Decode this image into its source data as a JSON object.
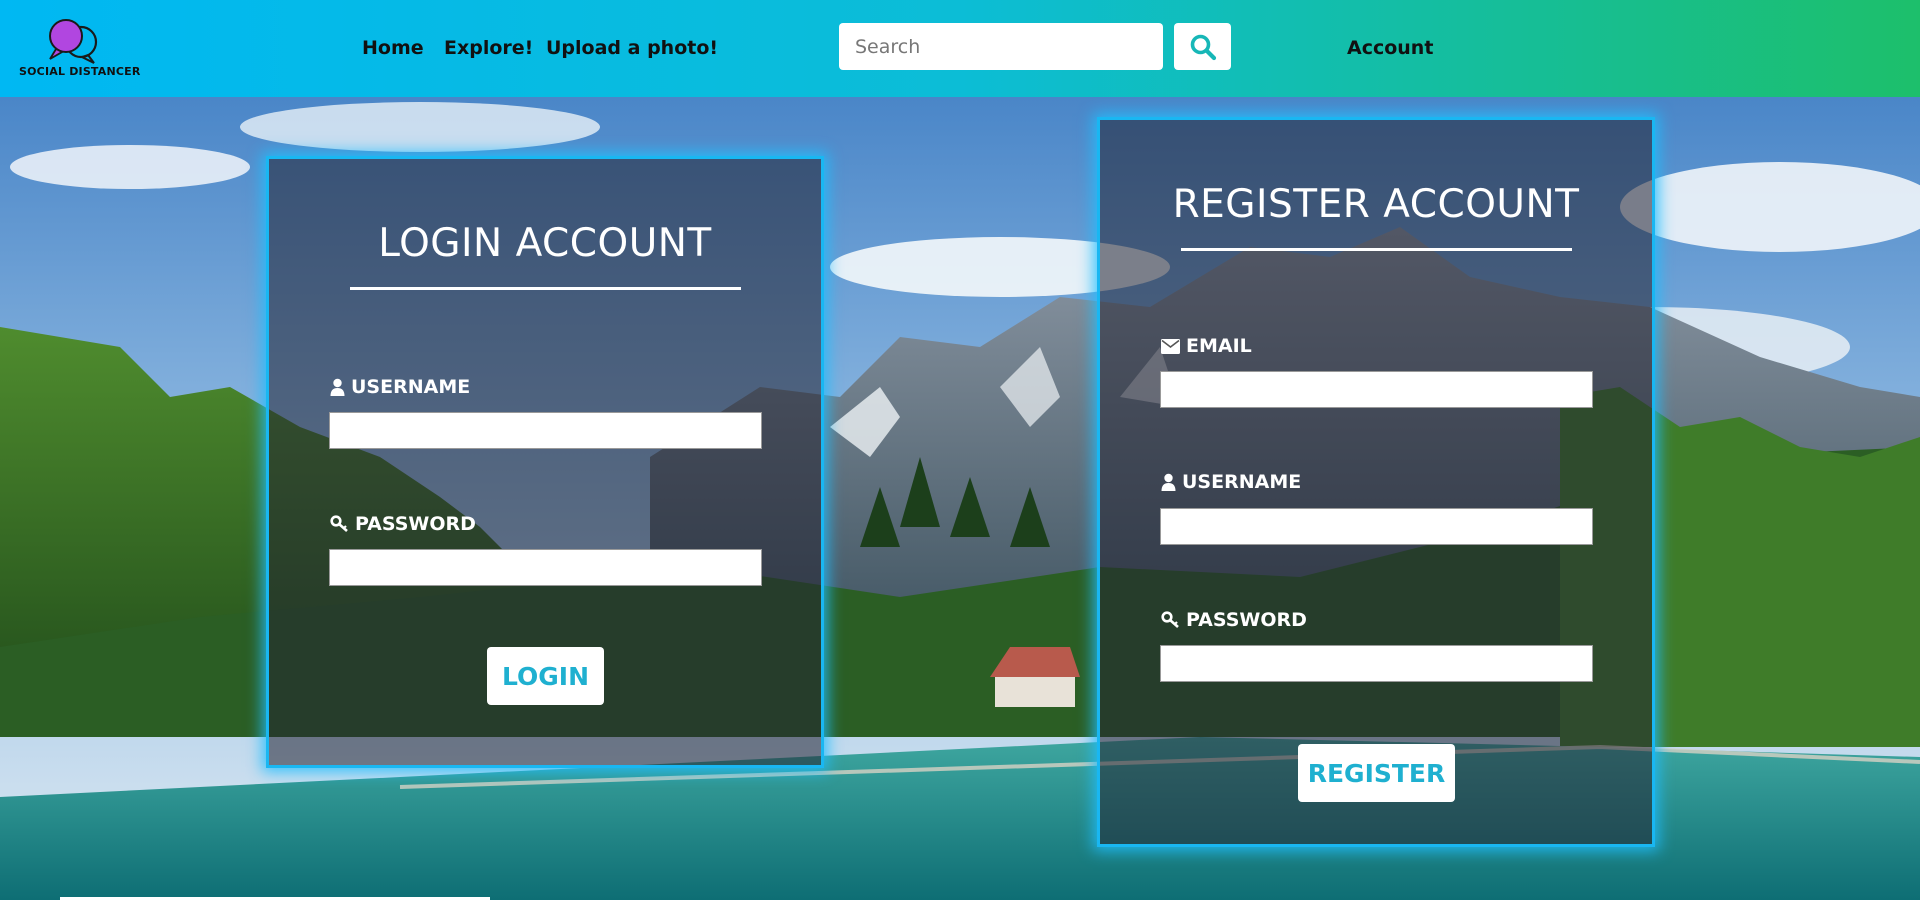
{
  "colors": {
    "accent": "#19b7f2",
    "nav_start": "#00b8f3",
    "nav_end": "#1dbf6b",
    "button_text": "#1fb0d0",
    "search_icon": "#17b7b7"
  },
  "nav": {
    "logo_text": "SOCIAL DISTANCER",
    "logo_icon": "chat-bubbles-icon",
    "links": [
      "Home",
      "Explore!",
      "Upload a photo!"
    ],
    "search_placeholder": "Search",
    "search_value": "",
    "search_icon": "search-icon",
    "account": "Account"
  },
  "login": {
    "title": "LOGIN ACCOUNT",
    "username_label": "USERNAME",
    "username_icon": "user-icon",
    "username_value": "",
    "password_label": "PASSWORD",
    "password_icon": "key-icon",
    "password_value": "",
    "button": "LOGIN"
  },
  "register": {
    "title": "REGISTER ACCOUNT",
    "email_label": "EMAIL",
    "email_icon": "envelope-icon",
    "email_value": "",
    "username_label": "USERNAME",
    "username_icon": "user-icon",
    "username_value": "",
    "password_label": "PASSWORD",
    "password_icon": "key-icon",
    "password_value": "",
    "button": "REGISTER"
  }
}
